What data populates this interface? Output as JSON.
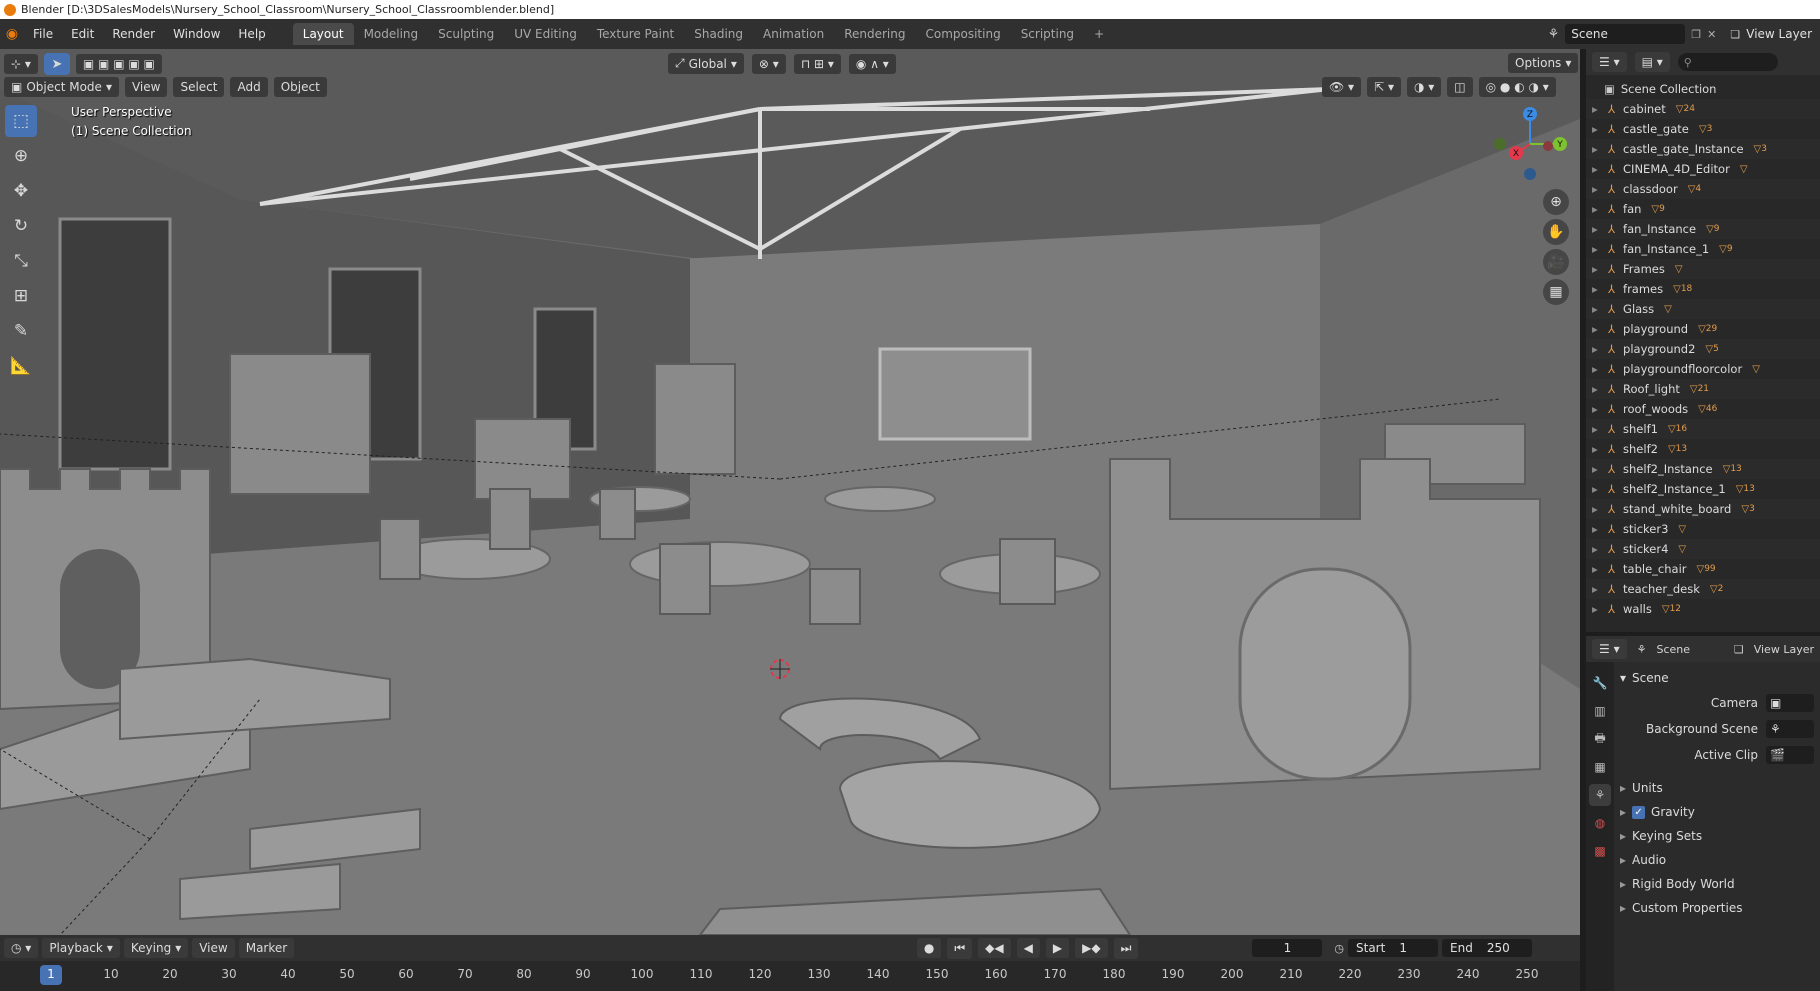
{
  "title_bar": {
    "text": "Blender [D:\\3DSalesModels\\Nursery_School_Classroom\\Nursery_School_Classroomblender.blend]"
  },
  "menu": {
    "items": [
      "File",
      "Edit",
      "Render",
      "Window",
      "Help"
    ],
    "workspaces": [
      "Layout",
      "Modeling",
      "Sculpting",
      "UV Editing",
      "Texture Paint",
      "Shading",
      "Animation",
      "Rendering",
      "Compositing",
      "Scripting"
    ],
    "active_workspace": "Layout",
    "add_tab": "+",
    "scene": "Scene",
    "view_layer": "View Layer"
  },
  "viewport": {
    "mode": "Object Mode",
    "menus": [
      "View",
      "Select",
      "Add",
      "Object"
    ],
    "transform": "Global",
    "options": "Options",
    "overlay_title": "User Perspective",
    "overlay_collection": "(1) Scene Collection",
    "gizmo_axes": [
      "X",
      "Y",
      "Z"
    ]
  },
  "outliner": {
    "root": "Scene Collection",
    "items": [
      {
        "name": "cabinet",
        "badge": "24"
      },
      {
        "name": "castle_gate",
        "badge": "3"
      },
      {
        "name": "castle_gate_Instance",
        "badge": "3"
      },
      {
        "name": "CINEMA_4D_Editor",
        "badge": ""
      },
      {
        "name": "classdoor",
        "badge": "4"
      },
      {
        "name": "fan",
        "badge": "9"
      },
      {
        "name": "fan_Instance",
        "badge": "9"
      },
      {
        "name": "fan_Instance_1",
        "badge": "9"
      },
      {
        "name": "Frames",
        "badge": ""
      },
      {
        "name": "frames",
        "badge": "18"
      },
      {
        "name": "Glass",
        "badge": ""
      },
      {
        "name": "playground",
        "badge": "29"
      },
      {
        "name": "playground2",
        "badge": "5"
      },
      {
        "name": "playgroundfloorcolor",
        "badge": ""
      },
      {
        "name": "Roof_light",
        "badge": "21"
      },
      {
        "name": "roof_woods",
        "badge": "46"
      },
      {
        "name": "shelf1",
        "badge": "16"
      },
      {
        "name": "shelf2",
        "badge": "13"
      },
      {
        "name": "shelf2_Instance",
        "badge": "13"
      },
      {
        "name": "shelf2_Instance_1",
        "badge": "13"
      },
      {
        "name": "stand_white_board",
        "badge": "3"
      },
      {
        "name": "sticker3",
        "badge": ""
      },
      {
        "name": "sticker4",
        "badge": ""
      },
      {
        "name": "table_chair",
        "badge": "99"
      },
      {
        "name": "teacher_desk",
        "badge": "2"
      },
      {
        "name": "walls",
        "badge": "12"
      }
    ]
  },
  "properties": {
    "header_scene": "Scene",
    "header_view_layer": "View Layer",
    "panel_title": "Scene",
    "fields": [
      {
        "label": "Camera"
      },
      {
        "label": "Background Scene"
      },
      {
        "label": "Active Clip"
      }
    ],
    "subpanels": [
      "Units",
      "Gravity",
      "Keying Sets",
      "Audio",
      "Rigid Body World",
      "Custom Properties"
    ],
    "gravity_checked": true
  },
  "timeline": {
    "menus": [
      "Playback",
      "Keying",
      "View",
      "Marker"
    ],
    "current_frame": "1",
    "start_label": "Start",
    "start": "1",
    "end_label": "End",
    "end": "250",
    "ruler": [
      "1",
      "10",
      "20",
      "30",
      "40",
      "50",
      "60",
      "70",
      "80",
      "90",
      "100",
      "110",
      "120",
      "130",
      "140",
      "150",
      "160",
      "170",
      "180",
      "190",
      "200",
      "210",
      "220",
      "230",
      "240",
      "250"
    ]
  },
  "colors": {
    "accent": "#4772b3",
    "x_axis": "#e5384b",
    "y_axis": "#7ec22f",
    "z_axis": "#3a8ce6",
    "object_orange": "#e29c4d",
    "mesh_green": "#5cc79a"
  }
}
